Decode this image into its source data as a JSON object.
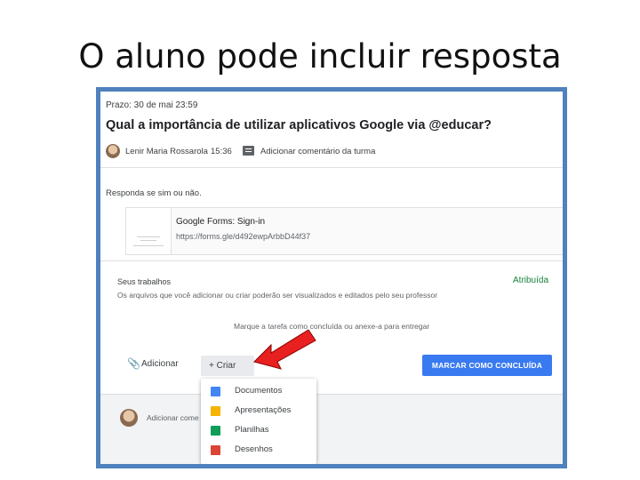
{
  "slide": {
    "title": "O aluno pode incluir resposta"
  },
  "assignment": {
    "deadline": "Prazo: 30 de mai 23:59",
    "question": "Qual a importância de utilizar aplicativos Google via @educar?",
    "author": "Lenir Maria Rossarola",
    "time": "15:36",
    "class_comment": "Adicionar comentário da turma",
    "instructions": "Responda se sim ou não."
  },
  "attachment": {
    "title": "Google Forms: Sign-in",
    "url": "https://forms.gle/d492ewpArbbD44f37"
  },
  "your_work": {
    "heading": "Seus trabalhos",
    "status": "Atribuída",
    "description": "Os arquivos que você adicionar ou criar poderão ser visualizados e editados pelo seu professor",
    "hint": "Marque a tarefa como concluída ou anexe-a para entregar",
    "add_label": "Adicionar",
    "create_label": "+ Criar",
    "done_label": "MARCAR COMO CONCLUÍDA"
  },
  "create_menu": {
    "items": [
      {
        "label": "Documentos",
        "icon": "docs-icon",
        "color": "#4285f4"
      },
      {
        "label": "Apresentações",
        "icon": "slides-icon",
        "color": "#f4b400"
      },
      {
        "label": "Planilhas",
        "icon": "sheets-icon",
        "color": "#0f9d58"
      },
      {
        "label": "Desenhos",
        "icon": "drawings-icon",
        "color": "#db4437"
      }
    ]
  },
  "private_comment": {
    "placeholder": "Adicionar come"
  },
  "colors": {
    "accent": "#3a7af0",
    "status_green": "#188038",
    "frame_border": "#4f81bd",
    "arrow": "#e82020"
  }
}
